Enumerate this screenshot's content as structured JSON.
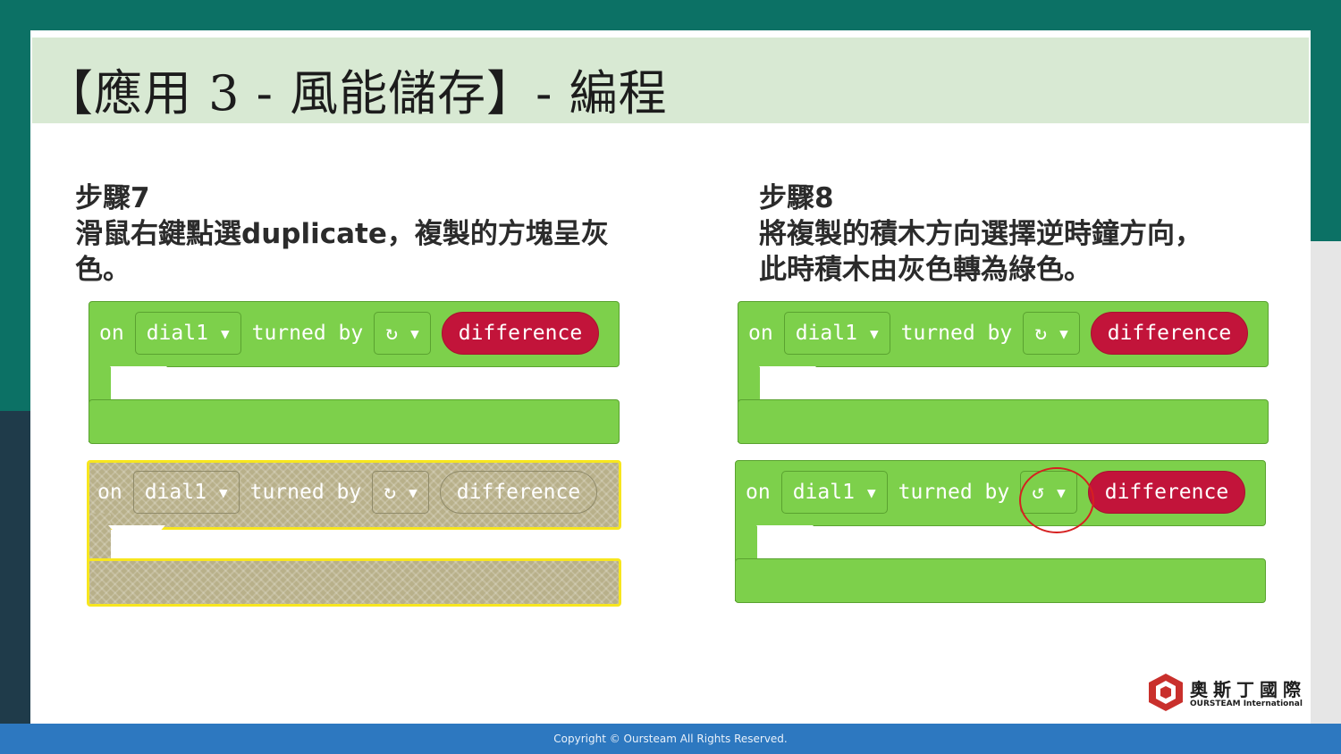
{
  "slide": {
    "title": "【應用 3 - 風能儲存】- 編程"
  },
  "step7": {
    "heading": "步驟7",
    "line1": "滑鼠右鍵點選duplicate，複製的方塊呈灰",
    "line2": "色。"
  },
  "step8": {
    "heading": "步驟8",
    "line1": "將複製的積木方向選擇逆時鐘方向，",
    "line2": "此時積木由灰色轉為綠色。"
  },
  "block": {
    "on": "on",
    "dial": "dial1",
    "turned_by": "turned by",
    "difference": "difference",
    "clockwise": "↻",
    "counterclockwise": "↺",
    "arrow": "▼"
  },
  "logo": {
    "cn": "奧斯丁國際",
    "en": "OURSTEAM International"
  },
  "footer": {
    "copyright": "Copyright © Oursteam All Rights Reserved."
  },
  "colors": {
    "block_green": "#7dd04b",
    "difference_red": "#c2143a",
    "duplicate_gray": "#b8b08a",
    "selection_yellow": "#f7e61e",
    "footer_blue": "#2d78c0"
  }
}
